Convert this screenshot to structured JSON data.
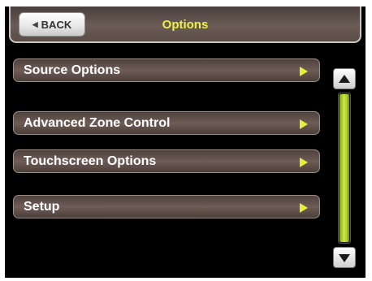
{
  "header": {
    "back_label": "BACK",
    "title": "Options"
  },
  "menu": {
    "items": [
      {
        "label": "Source Options"
      },
      {
        "label": "Advanced Zone Control"
      },
      {
        "label": "Touchscreen Options"
      },
      {
        "label": "Setup"
      }
    ]
  },
  "scrollbar": {
    "up_icon": "triangle-up-icon",
    "down_icon": "triangle-down-icon"
  },
  "colors": {
    "title": "#f0f04a",
    "arrow": "#e8ec3c",
    "scroll_thumb": "#b4d42e",
    "button_body": "#5e4e48"
  }
}
